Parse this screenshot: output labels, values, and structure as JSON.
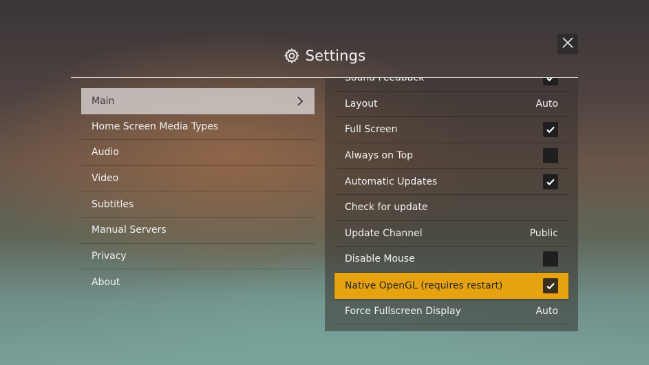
{
  "dialog": {
    "title": "Settings",
    "title_icon": "gear-icon",
    "close_icon": "close-icon"
  },
  "sidebar": {
    "items": [
      {
        "label": "Main",
        "active": true
      },
      {
        "label": "Home Screen Media Types",
        "active": false
      },
      {
        "label": "Audio",
        "active": false
      },
      {
        "label": "Video",
        "active": false
      },
      {
        "label": "Subtitles",
        "active": false
      },
      {
        "label": "Manual Servers",
        "active": false
      },
      {
        "label": "Privacy",
        "active": false
      },
      {
        "label": "About",
        "active": false
      }
    ]
  },
  "settings": {
    "rows": [
      {
        "label": "Sound Feedback",
        "type": "checkbox",
        "checked": true
      },
      {
        "label": "Layout",
        "type": "value",
        "value": "Auto"
      },
      {
        "label": "Full Screen",
        "type": "checkbox",
        "checked": true
      },
      {
        "label": "Always on Top",
        "type": "checkbox",
        "checked": false
      },
      {
        "label": "Automatic Updates",
        "type": "checkbox",
        "checked": true
      },
      {
        "label": "Check for update",
        "type": "action"
      },
      {
        "label": "Update Channel",
        "type": "value",
        "value": "Public"
      },
      {
        "label": "Disable Mouse",
        "type": "checkbox",
        "checked": false
      },
      {
        "label": "Native OpenGL (requires restart)",
        "type": "checkbox",
        "checked": true,
        "highlighted": true
      },
      {
        "label": "Force Fullscreen Display",
        "type": "value",
        "value": "Auto"
      }
    ]
  },
  "colors": {
    "highlight": "#e7a20f",
    "checkbox_bg": "#1f1f1f",
    "active_sidebar_bg": "#cdc6c4"
  }
}
